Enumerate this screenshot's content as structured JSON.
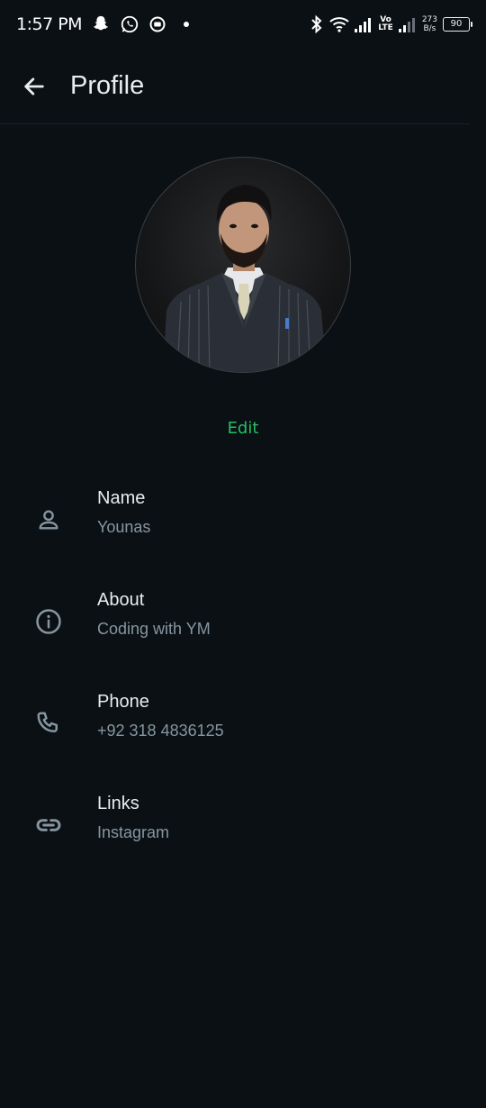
{
  "status_bar": {
    "time": "1:57 PM",
    "icons": [
      "snapchat-icon",
      "whatsapp-icon",
      "screen-record-icon",
      "dot-icon"
    ],
    "right_icons": [
      "bluetooth-icon",
      "wifi-icon",
      "signal-icon",
      "volte-icon",
      "signal-icon-2"
    ],
    "volte_top": "Vo",
    "volte_bottom": "LTE",
    "net_speed_value": "273",
    "net_speed_unit": "B/s",
    "battery": "90"
  },
  "app_bar": {
    "title": "Profile",
    "back_icon": "arrow-left-icon"
  },
  "profile": {
    "edit_label": "Edit"
  },
  "info": {
    "name": {
      "label": "Name",
      "value": "Younas",
      "icon": "person-icon"
    },
    "about": {
      "label": "About",
      "value": "Coding with YM",
      "icon": "info-icon"
    },
    "phone": {
      "label": "Phone",
      "value": "+92 318 4836125",
      "icon": "phone-icon"
    },
    "links": {
      "label": "Links",
      "value": "Instagram",
      "icon": "link-icon"
    }
  },
  "colors": {
    "background": "#0b1014",
    "accent": "#21c063",
    "text_primary": "#e9edef",
    "text_secondary": "#8696a0"
  }
}
